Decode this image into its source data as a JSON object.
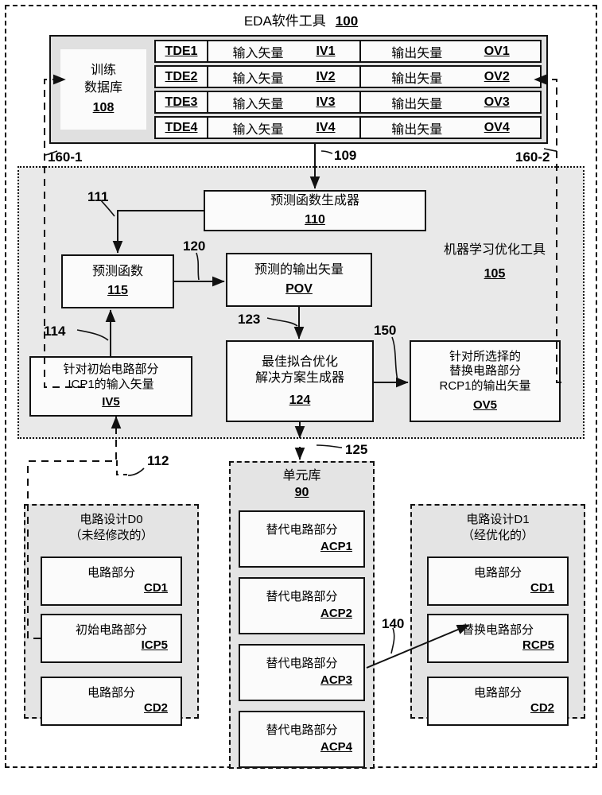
{
  "diagram": {
    "title": "EDA软件工具",
    "title_ref": "100"
  },
  "training_db": {
    "name_line1": "训练",
    "name_line2": "数据库",
    "ref": "108",
    "rows": [
      {
        "id": "TDE1",
        "input_label": "输入矢量",
        "input_ref": "IV1",
        "output_label": "输出矢量",
        "output_ref": "OV1"
      },
      {
        "id": "TDE2",
        "input_label": "输入矢量",
        "input_ref": "IV2",
        "output_label": "输出矢量",
        "output_ref": "OV2"
      },
      {
        "id": "TDE3",
        "input_label": "输入矢量",
        "input_ref": "IV3",
        "output_label": "输出矢量",
        "output_ref": "OV3"
      },
      {
        "id": "TDE4",
        "input_label": "输入矢量",
        "input_ref": "IV4",
        "output_label": "输出矢量",
        "output_ref": "OV4"
      }
    ]
  },
  "ml_tool": {
    "name_line1": "机器学习优化工具",
    "ref": "105",
    "generator": {
      "label": "预测函数生成器",
      "ref": "110"
    },
    "pred_function": {
      "label": "预测函数",
      "ref": "115"
    },
    "pov": {
      "label": "预测的输出矢量",
      "ref": "POV"
    },
    "iv5": {
      "line1": "针对初始电路部分",
      "line2": "ICP1的输入矢量",
      "ref": "IV5"
    },
    "best_fit": {
      "line1": "最佳拟合优化",
      "line2": "解决方案生成器",
      "ref": "124"
    },
    "ov5": {
      "line1": "针对所选择的",
      "line2": "替换电路部分",
      "line3": "RCP1的输出矢量",
      "ref": "OV5"
    }
  },
  "cell_library": {
    "title": "单元库",
    "ref": "90",
    "items": [
      {
        "label": "替代电路部分",
        "ref": "ACP1"
      },
      {
        "label": "替代电路部分",
        "ref": "ACP2"
      },
      {
        "label": "替代电路部分",
        "ref": "ACP3"
      },
      {
        "label": "替代电路部分",
        "ref": "ACP4"
      }
    ]
  },
  "design_d0": {
    "title_line1": "电路设计D0",
    "title_line2": "（未经修改的）",
    "items": [
      {
        "label": "电路部分",
        "ref": "CD1"
      },
      {
        "label": "初始电路部分",
        "ref": "ICP5"
      },
      {
        "label": "电路部分",
        "ref": "CD2"
      }
    ]
  },
  "design_d1": {
    "title_line1": "电路设计D1",
    "title_line2": "（经优化的）",
    "items": [
      {
        "label": "电路部分",
        "ref": "CD1"
      },
      {
        "label": "替换电路部分",
        "ref": "RCP5"
      },
      {
        "label": "电路部分",
        "ref": "CD2"
      }
    ]
  },
  "callouts": {
    "c160_1": "160-1",
    "c160_2": "160-2",
    "c109": "109",
    "c111": "111",
    "c120": "120",
    "c114": "114",
    "c123": "123",
    "c150": "150",
    "c125": "125",
    "c112": "112",
    "c140": "140"
  },
  "colors": {
    "line": "#111111",
    "ml_fill": "#e9e9e9",
    "db_fill": "#e0e0e0",
    "group_fill": "#e4e4e4",
    "box_fill": "#fbfbfb"
  }
}
